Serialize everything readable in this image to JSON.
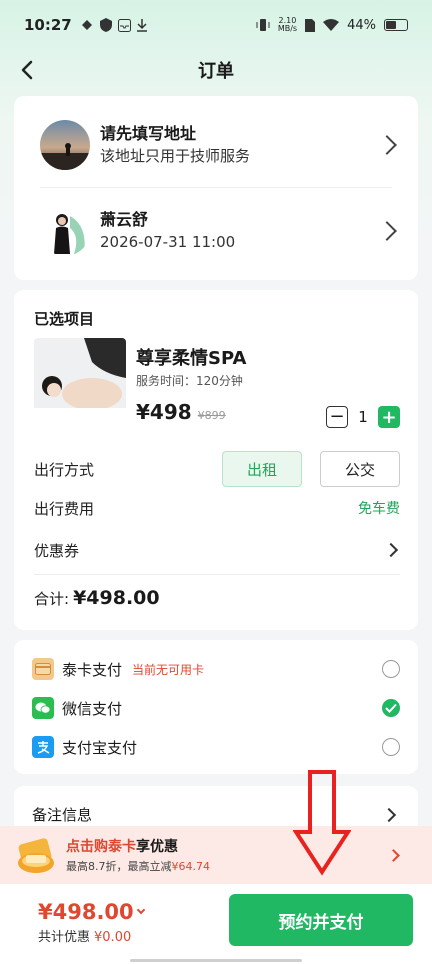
{
  "status_bar": {
    "time": "10:27",
    "net_speed_value": "2.10",
    "net_speed_unit": "MB/s",
    "battery_percent": "44%",
    "battery_level": 0.44
  },
  "nav": {
    "title": "订单"
  },
  "address": {
    "title": "请先填写地址",
    "subtitle": "该地址只用于技师服务"
  },
  "technician": {
    "name": "萧云舒",
    "datetime": "2026-07-31 11:00"
  },
  "project": {
    "section_title": "已选项目",
    "service_name": "尊享柔情SPA",
    "service_time": "服务时间：120分钟",
    "price": "¥498",
    "original_price": "¥899",
    "quantity": "1",
    "minus_label": "−",
    "plus_label": "+"
  },
  "travel": {
    "label": "出行方式",
    "options": [
      "出租",
      "公交"
    ],
    "selected": "出租"
  },
  "travel_fee": {
    "label": "出行费用",
    "value": "免车费"
  },
  "coupon": {
    "label": "优惠券"
  },
  "total": {
    "label": "合计:",
    "amount": "¥498.00"
  },
  "payment": {
    "options": [
      {
        "label": "泰卡支付",
        "note": "当前无可用卡",
        "icon": "card-icon",
        "checked": false
      },
      {
        "label": "微信支付",
        "note": "",
        "icon": "wechat-icon",
        "checked": true
      },
      {
        "label": "支付宝支付",
        "note": "",
        "icon": "alipay-icon",
        "checked": false
      }
    ]
  },
  "remark": {
    "label": "备注信息"
  },
  "promo": {
    "title_highlight": "点击购泰卡",
    "title_rest": "享优惠",
    "sub_prefix": "最高8.7折，最高立减",
    "sub_amount": "¥64.74"
  },
  "bottom": {
    "amount": "¥498.00",
    "discount_label": "共计优惠",
    "discount_value": "¥0.00",
    "pay_button": "预约并支付"
  },
  "colors": {
    "accent_green": "#21b864",
    "accent_red": "#e0472f"
  }
}
